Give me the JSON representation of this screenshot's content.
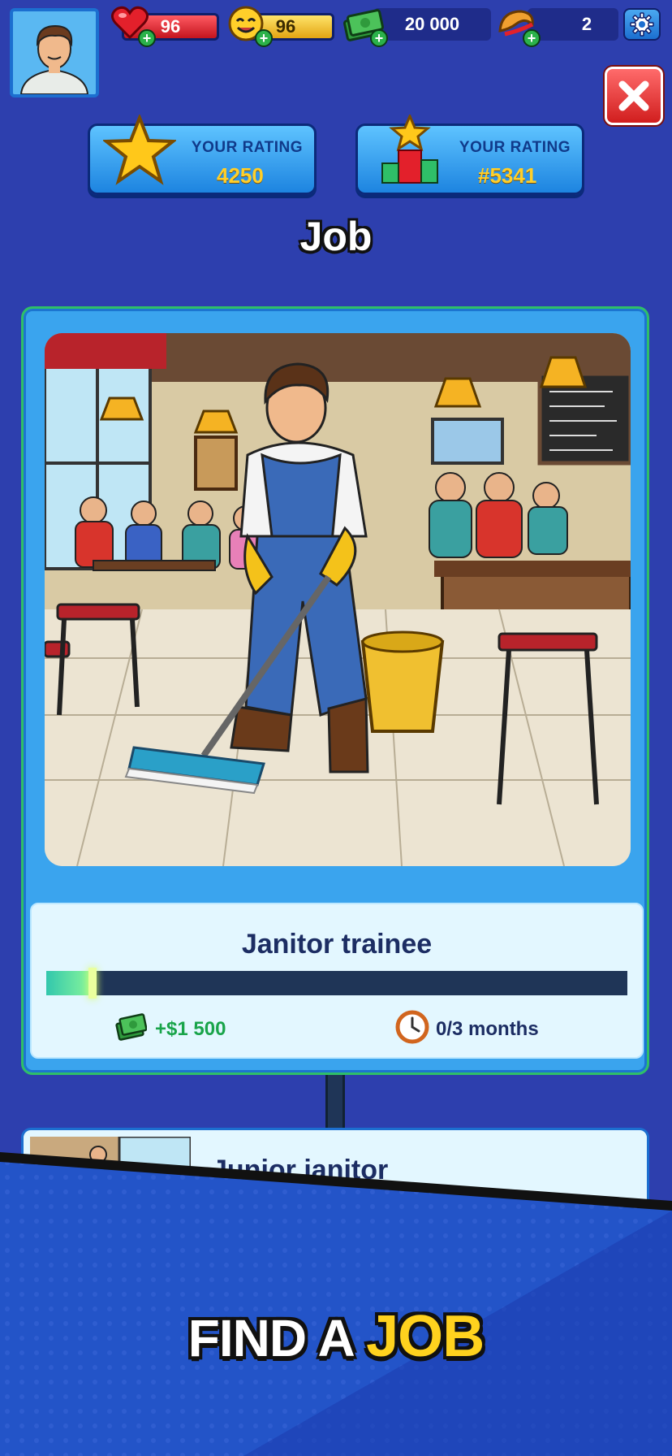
{
  "header": {
    "health": "96",
    "mood": "96",
    "money": "20 000",
    "tickets": "2"
  },
  "ratings": [
    {
      "label": "YOUR RATING",
      "value": "4250"
    },
    {
      "label": "YOUR RATING",
      "value": "#5341"
    }
  ],
  "page_title": "Job",
  "current_job": {
    "title": "Janitor trainee",
    "progress_fraction": 0.08,
    "salary": "+$1 500",
    "duration": "0/3 months"
  },
  "next_job": {
    "title": "Junior janitor"
  },
  "banner": {
    "part1": "FIND A ",
    "part2": "JOB"
  },
  "colors": {
    "background": "#2d3fae",
    "card": "#3aa4ee",
    "accent_gold": "#ffcf2a",
    "salary_green": "#19a44a"
  }
}
